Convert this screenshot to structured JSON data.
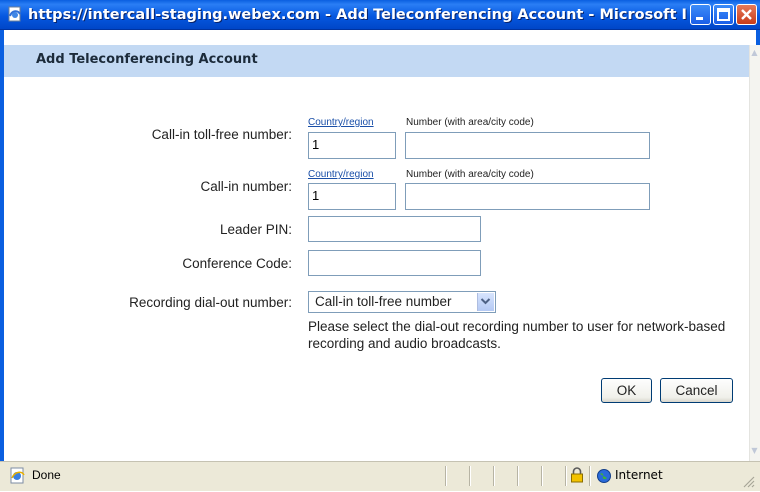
{
  "window": {
    "title": "https://intercall-staging.webex.com - Add Teleconferencing Account - Microsoft Inte..."
  },
  "dialog": {
    "title": "Add Teleconferencing Account"
  },
  "form": {
    "country_region_label": "Country/region",
    "number_label": "Number (with area/city code)",
    "toll_free": {
      "label": "Call-in toll-free number:",
      "country_value": "1",
      "number_value": ""
    },
    "call_in": {
      "label": "Call-in number:",
      "country_value": "1",
      "number_value": ""
    },
    "leader_pin": {
      "label": "Leader PIN:",
      "value": ""
    },
    "conference_code": {
      "label": "Conference Code:",
      "value": ""
    },
    "recording": {
      "label": "Recording dial-out number:",
      "selected": "Call-in toll-free number",
      "help": "Please select the dial-out recording number to user for network-based recording and audio broadcasts."
    }
  },
  "buttons": {
    "ok": "OK",
    "cancel": "Cancel"
  },
  "statusbar": {
    "status": "Done",
    "zone": "Internet"
  },
  "colors": {
    "titlebar": "#0a5fe0",
    "header_band": "#c3d9f3",
    "link": "#1a4fa8"
  }
}
